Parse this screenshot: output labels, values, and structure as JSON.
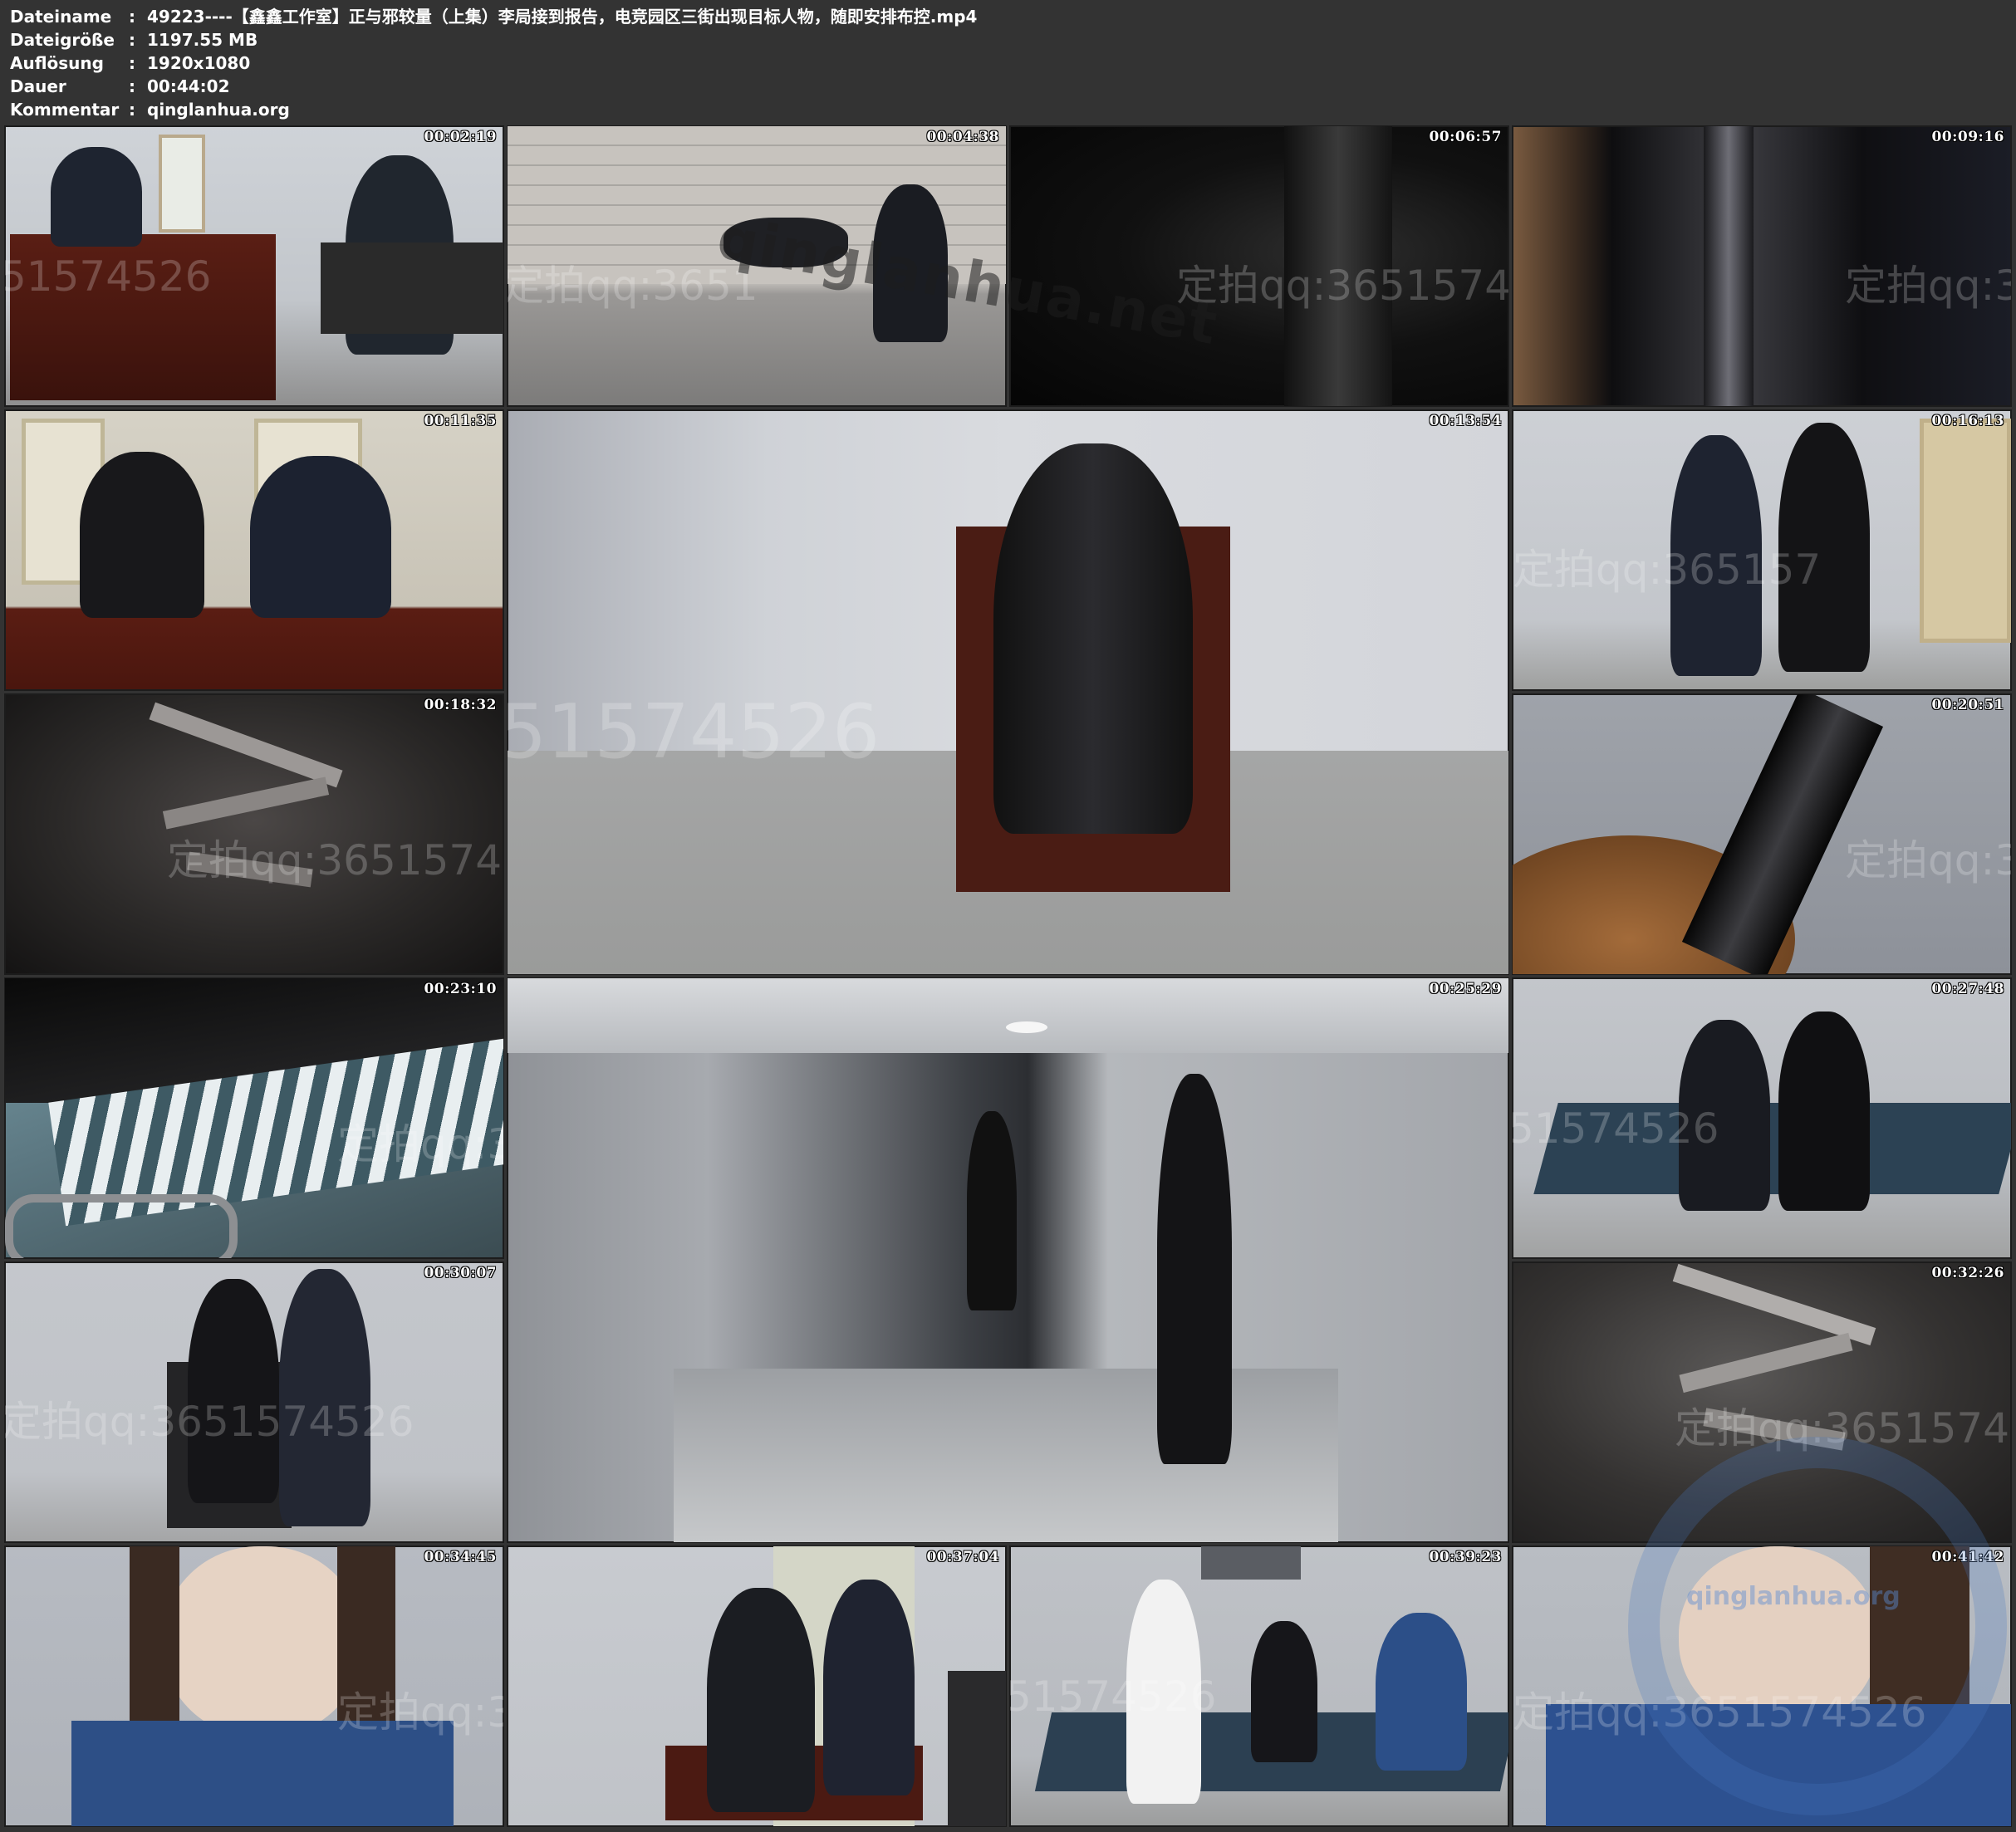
{
  "meta": {
    "rows": [
      {
        "key": "Dateiname",
        "value": "49223----【鑫鑫工作室】正与邪较量（上集）李局接到报告，电竞园区三街出现目标人物，随即安排布控.mp4"
      },
      {
        "key": "Dateigröße",
        "value": "1197.55 MB"
      },
      {
        "key": "Auflösung",
        "value": "1920x1080"
      },
      {
        "key": "Dauer",
        "value": "00:44:02"
      },
      {
        "key": "Kommentar",
        "value": "qinglanhua.org"
      }
    ],
    "separator": ":"
  },
  "thumbnails": [
    {
      "timestamp": "00:02:19",
      "watermark": "51574526"
    },
    {
      "timestamp": "00:04:38",
      "watermark": "定拍qq:3651"
    },
    {
      "timestamp": "00:06:57",
      "watermark": "定拍qq:3651574526"
    },
    {
      "timestamp": "00:09:16",
      "watermark": "定拍qq:36"
    },
    {
      "timestamp": "00:11:35",
      "watermark": ""
    },
    {
      "timestamp": "00:13:54",
      "watermark": "51574526"
    },
    {
      "timestamp": "00:16:13",
      "watermark": "定拍qq:365157"
    },
    {
      "timestamp": "00:18:32",
      "watermark": "定拍qq:3651574526"
    },
    {
      "timestamp": "00:20:51",
      "watermark": "定拍qq:36"
    },
    {
      "timestamp": "00:23:10",
      "watermark": "定拍qq:36"
    },
    {
      "timestamp": "00:25:29",
      "watermark": ""
    },
    {
      "timestamp": "00:27:48",
      "watermark": "51574526"
    },
    {
      "timestamp": "00:30:07",
      "watermark": "定拍qq:3651574526"
    },
    {
      "timestamp": "00:32:26",
      "watermark": "定拍qq:3651574526"
    },
    {
      "timestamp": "00:34:45",
      "watermark": "定拍qq:36"
    },
    {
      "timestamp": "00:37:04",
      "watermark": ""
    },
    {
      "timestamp": "00:39:23",
      "watermark": "51574526"
    },
    {
      "timestamp": "00:41:42",
      "watermark": "定拍qq:3651574526"
    }
  ],
  "overlay_watermark": "qinglanhua.net",
  "logo_watermark": "qinglanhua.org"
}
